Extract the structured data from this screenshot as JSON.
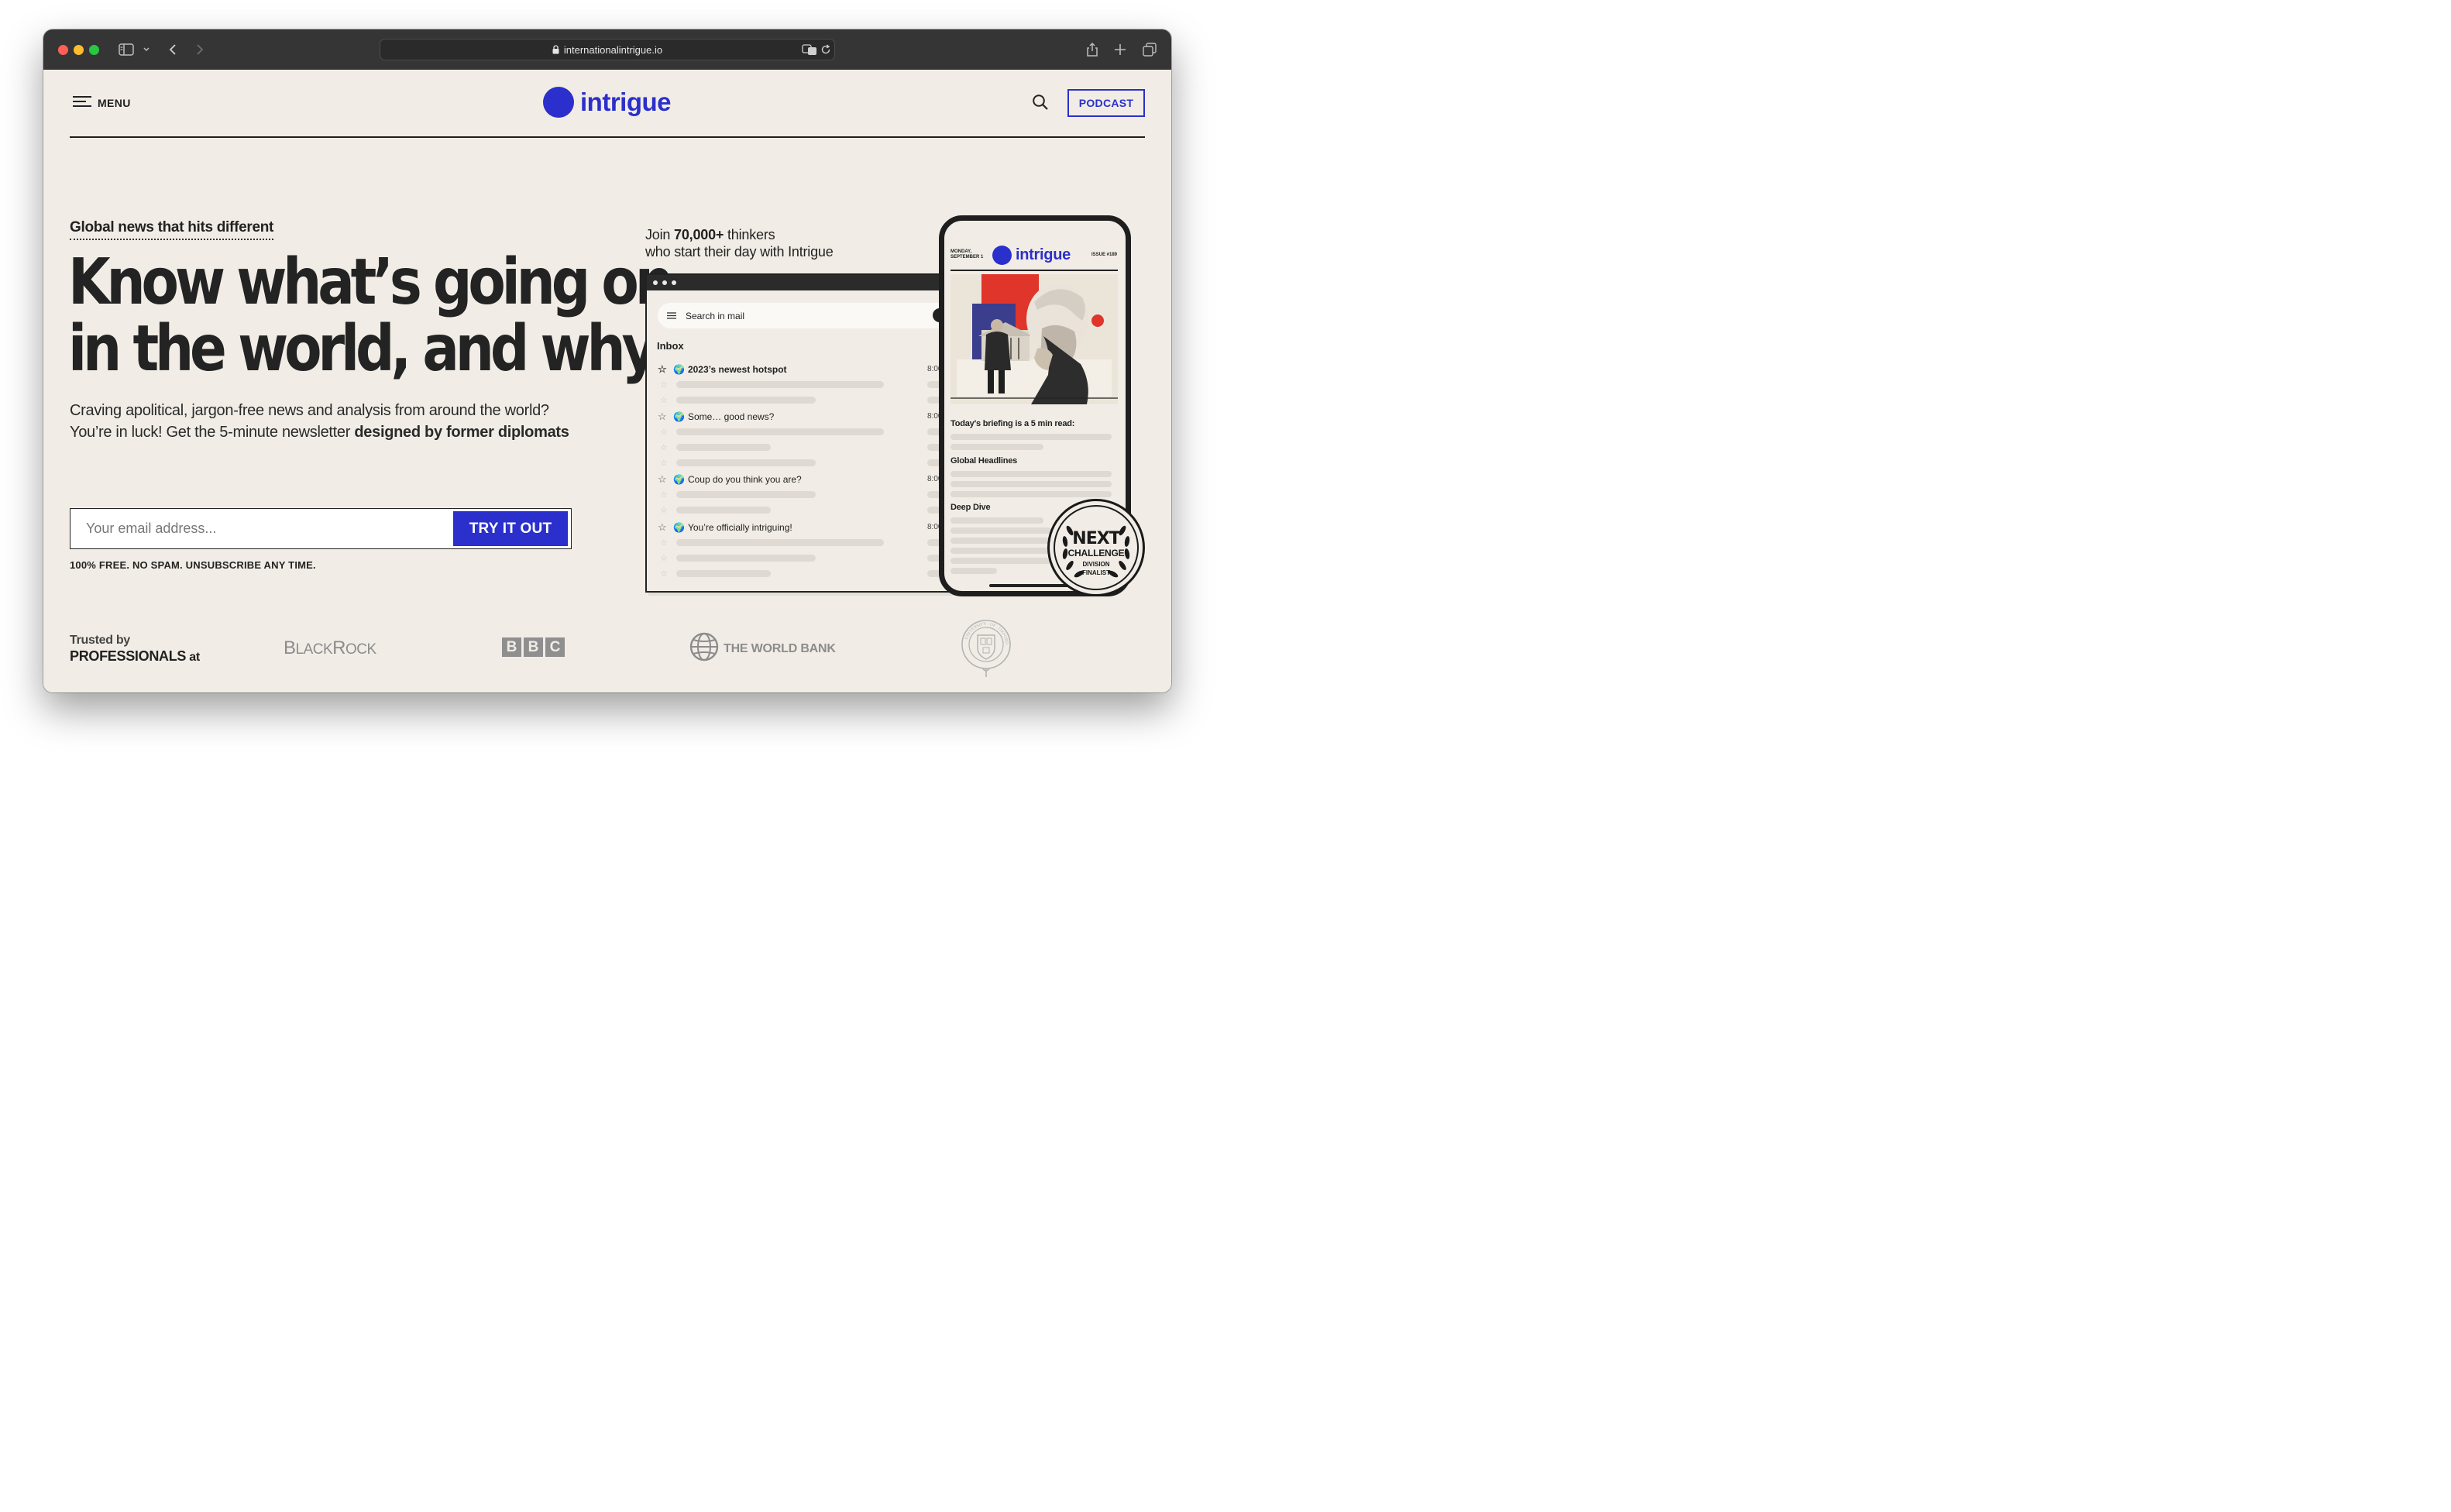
{
  "browser": {
    "url": "internationalintrigue.io",
    "traffic_lights": [
      "close",
      "minimize",
      "zoom"
    ]
  },
  "header": {
    "menu_label": "MENU",
    "logo_text": "intrigue",
    "podcast_label": "PODCAST",
    "brand_color": "#2b2fcb"
  },
  "hero": {
    "tagline": "Global news that hits different",
    "headline_line1": "Know what’s going on",
    "headline_line2": "in the world, and why",
    "subtext_line1": "Craving apolitical, jargon-free news and analysis from around the world?",
    "subtext_line2_plain": "You’re in luck! Get the 5-minute newsletter ",
    "subtext_line2_bold": "designed by former diplomats",
    "email_placeholder": "Your email address...",
    "cta_label": "TRY IT OUT",
    "fineprint": "100% FREE. NO SPAM. UNSUBSCRIBE ANY TIME."
  },
  "mockup": {
    "join_prefix": "Join ",
    "join_count": "70,000+",
    "join_suffix": " thinkers",
    "join_line2": "who start their day with Intrigue",
    "mail": {
      "search_placeholder": "Search in mail",
      "inbox_label": "Inbox",
      "emails": [
        {
          "subject": "2023’s newest hotspot",
          "time": "8:00",
          "bold": true
        },
        {
          "subject": "Some… good news?",
          "time": "8:00",
          "bold": false
        },
        {
          "subject": "Coup do you think you are?",
          "time": "8:00",
          "bold": false
        },
        {
          "subject": "You’re officially intriguing!",
          "time": "8:00",
          "bold": false
        }
      ]
    },
    "phone": {
      "date_line1": "MONDAY,",
      "date_line2": "SEPTEMBER 1",
      "logo_text": "intrigue",
      "issue": "ISSUE #189",
      "briefing": "Today's briefing is a 5 min read:",
      "section1": "Global Headlines",
      "section2": "Deep Dive"
    },
    "badge": {
      "line1": "NEXT",
      "line2": "CHALLENGE",
      "line3": "DIVISION",
      "line4": "FINALIST"
    }
  },
  "trusted": {
    "line1": "Trusted by",
    "line2": "PROFESSIONALS",
    "line2_suffix": " at",
    "logos": {
      "blackrock": "BLACKROCK",
      "bbc": [
        "B",
        "B",
        "C"
      ],
      "worldbank": "THE WORLD BANK",
      "oxford": "UNIVERSITY OF OXFORD"
    }
  }
}
